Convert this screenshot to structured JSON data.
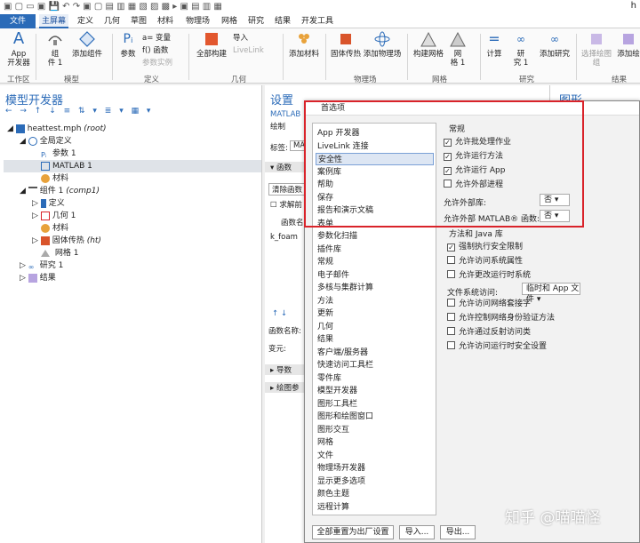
{
  "window": {
    "title_fragment": "h"
  },
  "tabs": [
    "文件",
    "主屏幕",
    "定义",
    "几何",
    "草图",
    "材料",
    "物理场",
    "网格",
    "研究",
    "结果",
    "开发工具"
  ],
  "ribbon": {
    "app_dev": "App\n开发器",
    "component": "组\n件 1",
    "add_component": "添加组件",
    "parameters": "参数",
    "variables": "a= 变量",
    "functions": "f() 函数",
    "param_case": "参数实例",
    "full_build": "全部构建",
    "import": "导入",
    "livelink": "LiveLink",
    "add_material": "添加材料",
    "heat_transfer": "固体传热",
    "add_physics": "添加物理场",
    "build_mesh": "构建网格",
    "mesh1": "网\n格 1",
    "compute": "计算",
    "study1": "研\n究 1",
    "add_study": "添加研究",
    "select_plot": "选择绘图组",
    "add_plot": "添加绘",
    "groups": [
      "工作区",
      "模型",
      "定义",
      "几何",
      "物理场",
      "网格",
      "研究",
      "结果"
    ]
  },
  "model_builder": {
    "title": "模型开发器",
    "toolbar": "← → ↑ ↓ ≡ ⇅ ▾ ≣ ▾ ▦ ▾",
    "tree": [
      {
        "label": "heattest.mph",
        "suffix": "(root)"
      },
      {
        "label": "全局定义"
      },
      {
        "label": "参数 1"
      },
      {
        "label": "MATLAB 1"
      },
      {
        "label": "材料"
      },
      {
        "label": "组件 1",
        "suffix": "(comp1)"
      },
      {
        "label": "定义"
      },
      {
        "label": "几何 1"
      },
      {
        "label": "材料"
      },
      {
        "label": "固体传热",
        "suffix": "(ht)"
      },
      {
        "label": "网格 1"
      },
      {
        "label": "研究 1"
      },
      {
        "label": "结果"
      }
    ]
  },
  "settings": {
    "title": "设置",
    "sub": "MATLAB",
    "draw": "绘制",
    "tag_label": "标签:",
    "tag_value": "MA",
    "functions": "函数",
    "clear": "清除函数",
    "solve": "求解前",
    "fname_header": "函数名",
    "fname_value": "k_foam",
    "func_name_label": "函数名称:",
    "arg_label": "变元:",
    "derivative": "导数",
    "plot_params": "绘图参"
  },
  "graphics": {
    "title": "图形"
  },
  "dialog": {
    "title": "首选项",
    "list": [
      "App 开发器",
      "LiveLink 连接",
      "安全性",
      "案例库",
      "帮助",
      "保存",
      "报告和演示文稿",
      "表单",
      "参数化扫描",
      "插件库",
      "常规",
      "电子邮件",
      "多核与集群计算",
      "方法",
      "更新",
      "几何",
      "结果",
      "客户端/服务器",
      "快速访问工具栏",
      "零件库",
      "模型开发器",
      "图形工具栏",
      "图形和绘图窗口",
      "图形交互",
      "网格",
      "文件",
      "物理场开发器",
      "显示更多选项",
      "颜色主题",
      "远程计算"
    ],
    "selected": "安全性",
    "general_header": "常规",
    "checks_general": [
      {
        "label": "允许批处理作业",
        "checked": true
      },
      {
        "label": "允许运行方法",
        "checked": true
      },
      {
        "label": "允许运行 App",
        "checked": true
      },
      {
        "label": "允许外部进程",
        "checked": false
      }
    ],
    "allow_ext_lib": "允许外部库:",
    "allow_ext_lib_value": "否",
    "allow_ext_matlab": "允许外部 MATLAB® 函数:",
    "allow_ext_matlab_value": "否",
    "java_header": "方法和 Java 库",
    "checks_java": [
      {
        "label": "强制执行安全限制",
        "checked": true
      },
      {
        "label": "允许访问系统属性",
        "checked": false
      },
      {
        "label": "允许更改运行时系统",
        "checked": false
      }
    ],
    "fs_access": "文件系统访问:",
    "fs_access_value": "临时和 App 文件",
    "checks_java2": [
      {
        "label": "允许访问网络套接字",
        "checked": false
      },
      {
        "label": "允许控制网络身份验证方法",
        "checked": false
      },
      {
        "label": "允许通过反射访问类",
        "checked": false
      },
      {
        "label": "允许访问运行时安全设置",
        "checked": false
      }
    ],
    "reset": "全部重置为出厂设置",
    "import": "导入...",
    "export": "导出..."
  },
  "watermark": "知乎 @喵喵怪",
  "colors": {
    "accent": "#2b6bb8",
    "highlight_box": "#d9232a"
  }
}
